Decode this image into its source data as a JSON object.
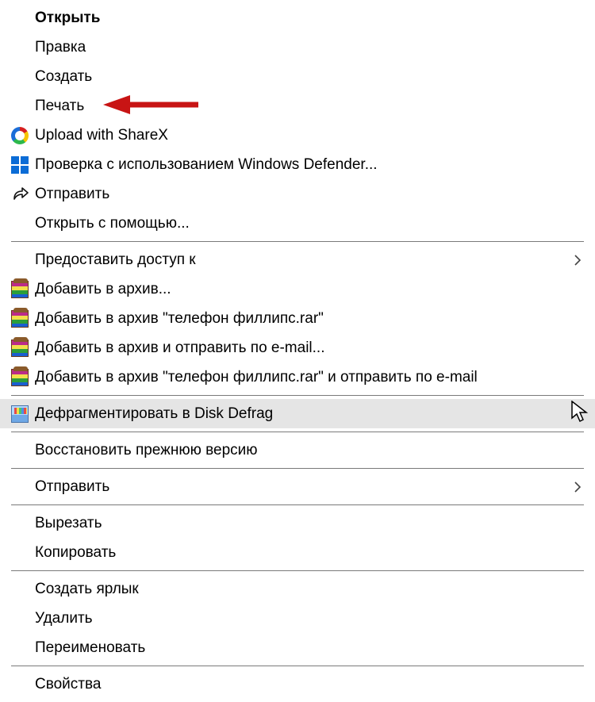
{
  "menu": {
    "items": [
      {
        "label": "Открыть",
        "bold": true,
        "submenu": false,
        "icon": null
      },
      {
        "label": "Правка",
        "bold": false,
        "submenu": false,
        "icon": null
      },
      {
        "label": "Создать",
        "bold": false,
        "submenu": false,
        "icon": null
      },
      {
        "label": "Печать",
        "bold": false,
        "submenu": false,
        "icon": null
      },
      {
        "label": "Upload with ShareX",
        "bold": false,
        "submenu": false,
        "icon": "sharex"
      },
      {
        "label": "Проверка с использованием Windows Defender...",
        "bold": false,
        "submenu": false,
        "icon": "defender"
      },
      {
        "label": "Отправить",
        "bold": false,
        "submenu": false,
        "icon": "share-arrow"
      },
      {
        "label": "Открыть с помощью...",
        "bold": false,
        "submenu": false,
        "icon": null
      },
      {
        "sep": true
      },
      {
        "label": "Предоставить доступ к",
        "bold": false,
        "submenu": true,
        "icon": null
      },
      {
        "label": "Добавить в архив...",
        "bold": false,
        "submenu": false,
        "icon": "winrar"
      },
      {
        "label": "Добавить в архив \"телефон филлипс.rar\"",
        "bold": false,
        "submenu": false,
        "icon": "winrar"
      },
      {
        "label": "Добавить в архив и отправить по e-mail...",
        "bold": false,
        "submenu": false,
        "icon": "winrar"
      },
      {
        "label": "Добавить в архив \"телефон филлипс.rar\" и отправить по e-mail",
        "bold": false,
        "submenu": false,
        "icon": "winrar"
      },
      {
        "sep": true
      },
      {
        "label": "Дефрагментировать в Disk Defrag",
        "bold": false,
        "submenu": false,
        "icon": "defrag",
        "hover": true
      },
      {
        "sep": true
      },
      {
        "label": "Восстановить прежнюю версию",
        "bold": false,
        "submenu": false,
        "icon": null
      },
      {
        "sep": true
      },
      {
        "label": "Отправить",
        "bold": false,
        "submenu": true,
        "icon": null
      },
      {
        "sep": true
      },
      {
        "label": "Вырезать",
        "bold": false,
        "submenu": false,
        "icon": null
      },
      {
        "label": "Копировать",
        "bold": false,
        "submenu": false,
        "icon": null
      },
      {
        "sep": true
      },
      {
        "label": "Создать ярлык",
        "bold": false,
        "submenu": false,
        "icon": null
      },
      {
        "label": "Удалить",
        "bold": false,
        "submenu": false,
        "icon": null
      },
      {
        "label": "Переименовать",
        "bold": false,
        "submenu": false,
        "icon": null
      },
      {
        "sep": true
      },
      {
        "label": "Свойства",
        "bold": false,
        "submenu": false,
        "icon": null
      }
    ]
  },
  "annotation": {
    "arrow_target_item": "Печать",
    "arrow_color": "#d22"
  }
}
